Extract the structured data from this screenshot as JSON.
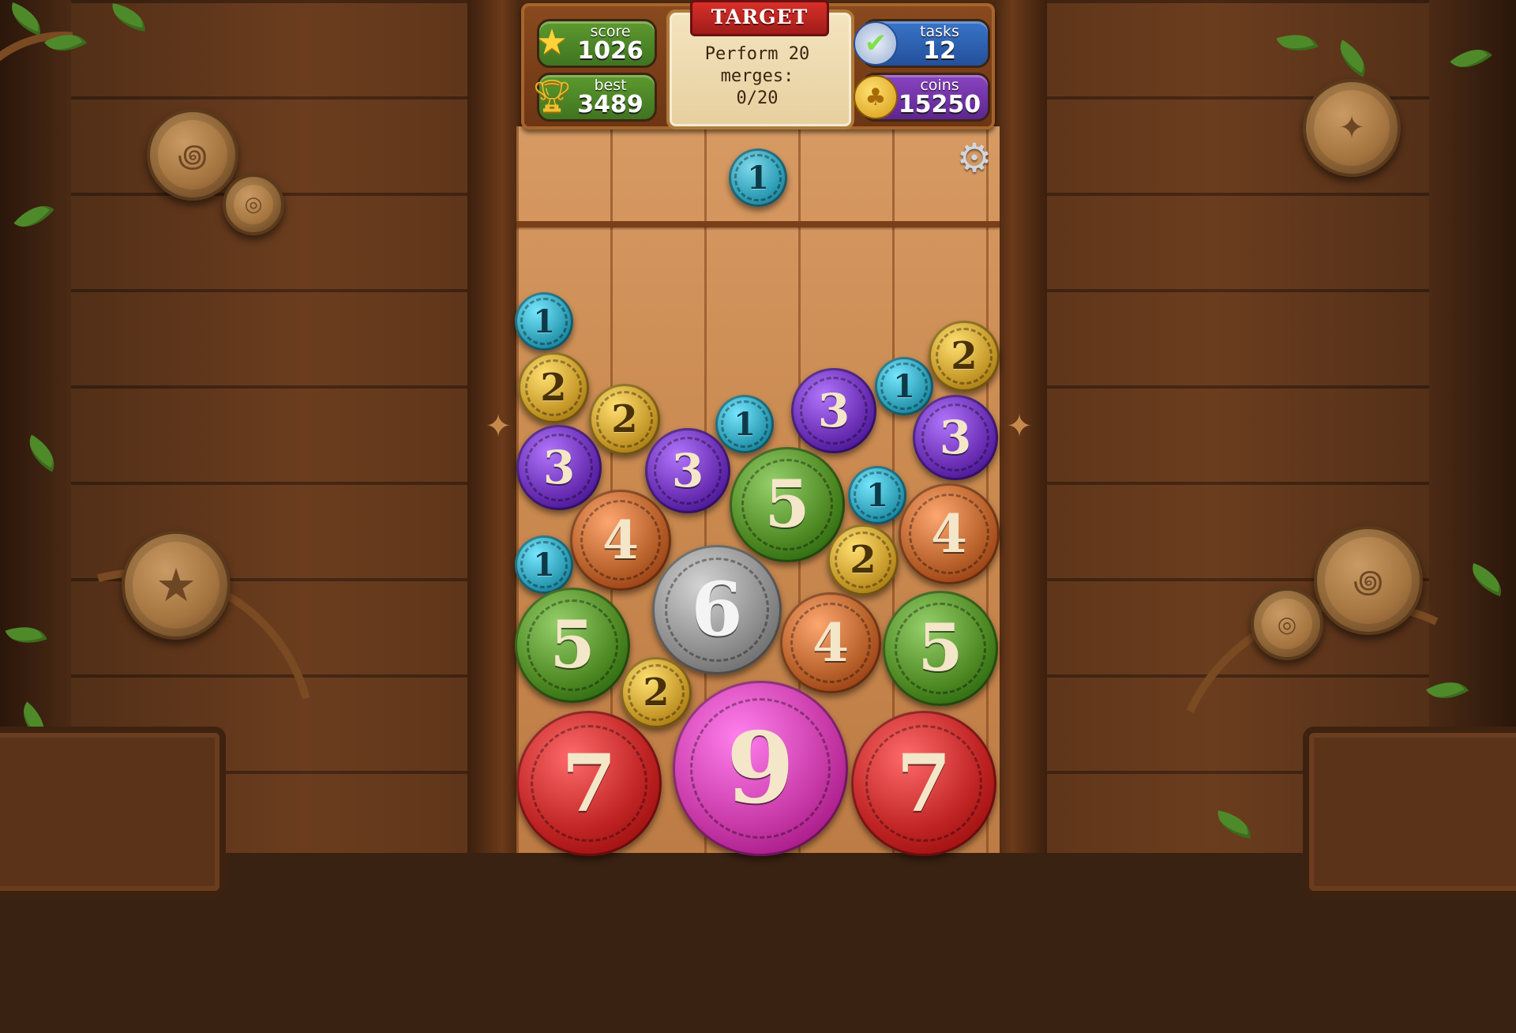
{
  "hud": {
    "score_label": "score",
    "score_value": "1026",
    "best_label": "best",
    "best_value": "3489",
    "tasks_label": "tasks",
    "tasks_value": "12",
    "coins_label": "coins",
    "coins_value": "15250",
    "target_title": "TARGET",
    "target_line1": "Perform 20",
    "target_line2": "merges:",
    "target_progress": "0/20"
  },
  "next_coin": "1",
  "coins": [
    {
      "label": "1",
      "tier": 1
    },
    {
      "label": "2",
      "tier": 2
    },
    {
      "label": "2",
      "tier": 2
    },
    {
      "label": "1",
      "tier": 1
    },
    {
      "label": "3",
      "tier": 3
    },
    {
      "label": "1",
      "tier": 1
    },
    {
      "label": "2",
      "tier": 2
    },
    {
      "label": "3",
      "tier": 3
    },
    {
      "label": "3",
      "tier": 3
    },
    {
      "label": "3",
      "tier": 3
    },
    {
      "label": "5",
      "tier": 5
    },
    {
      "label": "1",
      "tier": 1
    },
    {
      "label": "4",
      "tier": 4
    },
    {
      "label": "4",
      "tier": 4
    },
    {
      "label": "1",
      "tier": 1
    },
    {
      "label": "2",
      "tier": 2
    },
    {
      "label": "6",
      "tier": 6
    },
    {
      "label": "5",
      "tier": 5
    },
    {
      "label": "4",
      "tier": 4
    },
    {
      "label": "5",
      "tier": 5
    },
    {
      "label": "2",
      "tier": 2
    },
    {
      "label": "7",
      "tier": 7
    },
    {
      "label": "9",
      "tier": 9
    },
    {
      "label": "7",
      "tier": 7
    }
  ],
  "tier_colors": {
    "1": "#2fa0b8",
    "2": "#c79a2a",
    "3": "#6a2fb5",
    "4": "#b8602a",
    "5": "#4f8a24",
    "6": "#8e8e8e",
    "7": "#c02424",
    "9": "#c83aa8"
  },
  "icons": {
    "score": "star-icon",
    "best": "trophy-icon",
    "tasks": "checklist-icon",
    "coins": "clover-coin-icon",
    "settings": "gear-icon"
  }
}
